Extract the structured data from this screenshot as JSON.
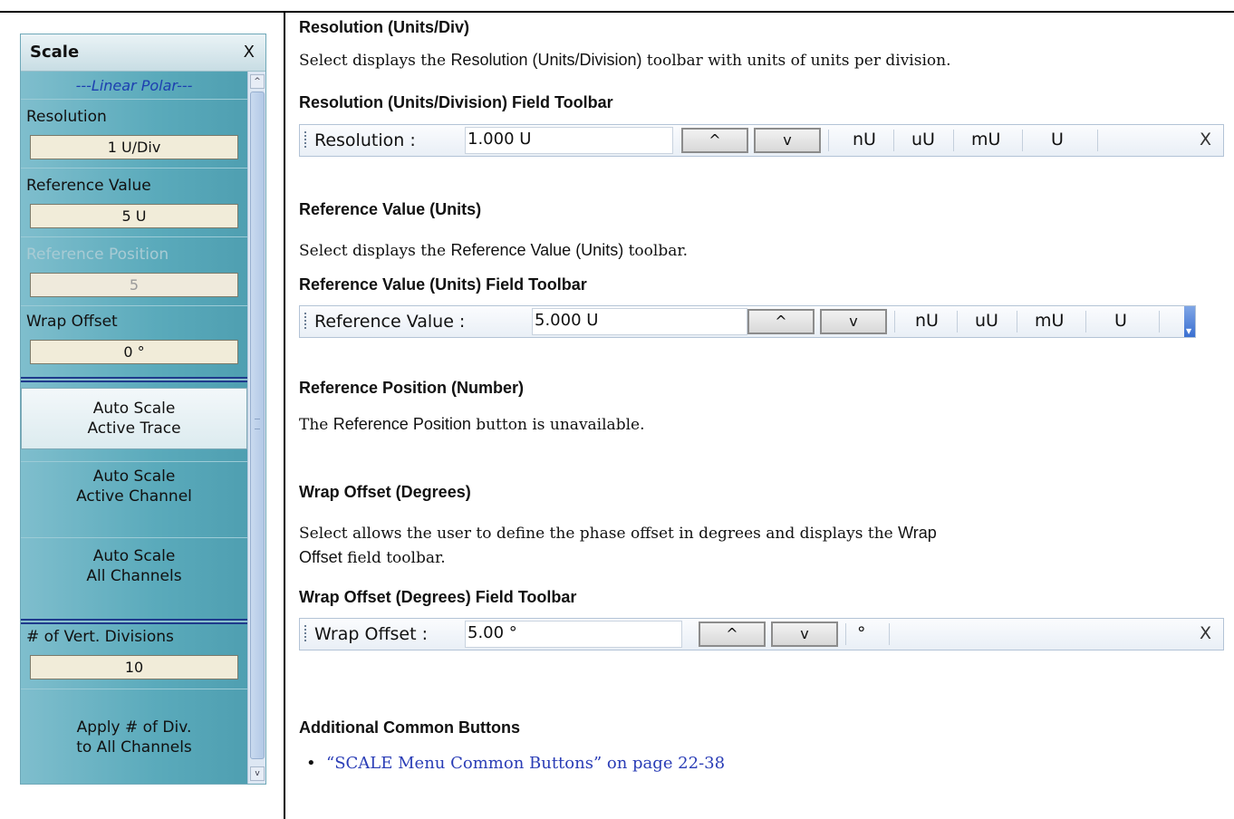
{
  "menu": {
    "title": "Scale",
    "close": "X",
    "heading": "---Linear Polar---",
    "resolution_label": "Resolution",
    "resolution_value": "1 U/Div",
    "ref_value_label": "Reference Value",
    "ref_value_value": "5 U",
    "ref_position_label": "Reference Position",
    "ref_position_value": "5",
    "wrap_label": "Wrap Offset",
    "wrap_value": "0 °",
    "auto_active_trace": [
      "Auto Scale",
      "Active Trace"
    ],
    "auto_active_channel": [
      "Auto Scale",
      "Active Channel"
    ],
    "auto_all_channels": [
      "Auto Scale",
      "All Channels"
    ],
    "vert_div_label": "# of Vert. Divisions",
    "vert_div_value": "10",
    "apply_div": [
      "Apply # of Div.",
      "to All Channels"
    ],
    "scroll_up": "^",
    "scroll_down": "v"
  },
  "content": {
    "h_res": "Resolution (Units/Div)",
    "p_res_pre": "Select displays the ",
    "p_res_sf": "Resolution (Units/Division)",
    "p_res_post": " toolbar with units of units per division.",
    "h_res_tb": "Resolution (Units/Division) Field Toolbar",
    "h_ref": "Reference Value (Units)",
    "p_ref_pre": "Select displays the ",
    "p_ref_sf": "Reference Value (Units)",
    "p_ref_post": " toolbar.",
    "h_ref_tb": "Reference Value (Units) Field Toolbar",
    "h_pos": "Reference Position (Number)",
    "p_pos_pre": "The ",
    "p_pos_sf": "Reference Position",
    "p_pos_post": " button is unavailable.",
    "h_wrap": "Wrap Offset (Degrees)",
    "p_wrap_l1_pre": "Select allows the user to define the phase offset in degrees and displays the ",
    "p_wrap_l1_sf": "Wrap",
    "p_wrap_l2_sf": "Offset",
    "p_wrap_l2_post": " field toolbar.",
    "h_wrap_tb": "Wrap Offset (Degrees) Field Toolbar",
    "h_common": "Additional Common Buttons",
    "bullet_link": "“SCALE Menu Common Buttons” on page 22-38",
    "bullet_dot": "•"
  },
  "toolbars": {
    "resolution": {
      "label": "Resolution :",
      "value": "1.000  U",
      "up": "^",
      "down": "v",
      "units": [
        "nU",
        "uU",
        "mU",
        "U"
      ],
      "close": "X"
    },
    "reference": {
      "label": "Reference Value :",
      "value": "5.000  U",
      "up": "^",
      "down": "v",
      "units": [
        "nU",
        "uU",
        "mU",
        "U"
      ]
    },
    "wrap": {
      "label": "Wrap Offset :",
      "value": "5.00 °",
      "up": "^",
      "down": "v",
      "units": [
        "°"
      ],
      "close": "X"
    }
  }
}
